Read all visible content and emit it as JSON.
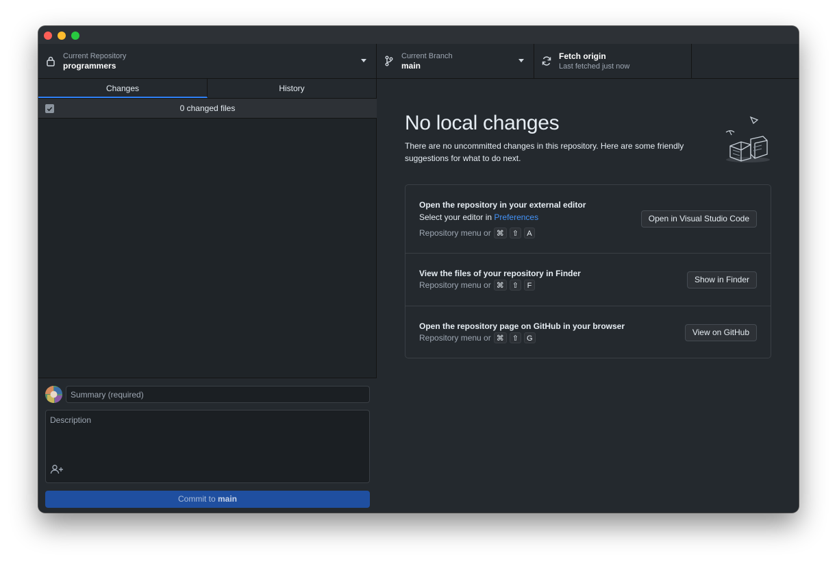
{
  "toolbar": {
    "repo": {
      "label": "Current Repository",
      "value": "programmers"
    },
    "branch": {
      "label": "Current Branch",
      "value": "main"
    },
    "fetch": {
      "label": "Fetch origin",
      "status": "Last fetched just now"
    }
  },
  "sidebar": {
    "tabs": [
      {
        "label": "Changes",
        "active": true
      },
      {
        "label": "History",
        "active": false
      }
    ],
    "changed_files": "0 changed files",
    "summary_placeholder": "Summary (required)",
    "description_placeholder": "Description",
    "commit": {
      "prefix": "Commit to ",
      "branch": "main"
    }
  },
  "main": {
    "title": "No local changes",
    "subtitle": "There are no uncommitted changes in this repository. Here are some friendly suggestions for what to do next.",
    "cards": [
      {
        "title": "Open the repository in your external editor",
        "line_prefix": "Select your editor in ",
        "line_link": "Preferences",
        "hint": "Repository menu or",
        "keys": [
          "⌘",
          "⇧",
          "A"
        ],
        "button": "Open in Visual Studio Code"
      },
      {
        "title": "View the files of your repository in Finder",
        "hint": "Repository menu or",
        "keys": [
          "⌘",
          "⇧",
          "F"
        ],
        "button": "Show in Finder"
      },
      {
        "title": "Open the repository page on GitHub in your browser",
        "hint": "Repository menu or",
        "keys": [
          "⌘",
          "⇧",
          "G"
        ],
        "button": "View on GitHub"
      }
    ]
  },
  "icons": [
    "lock-icon",
    "branch-icon",
    "sync-icon",
    "chevron-down-icon",
    "check-icon",
    "add-coauthor-icon"
  ],
  "colors": {
    "accent": "#2f81f7",
    "link": "#4493f8",
    "commit_button": "#1f4fa0",
    "window_bg": "#24292e"
  }
}
